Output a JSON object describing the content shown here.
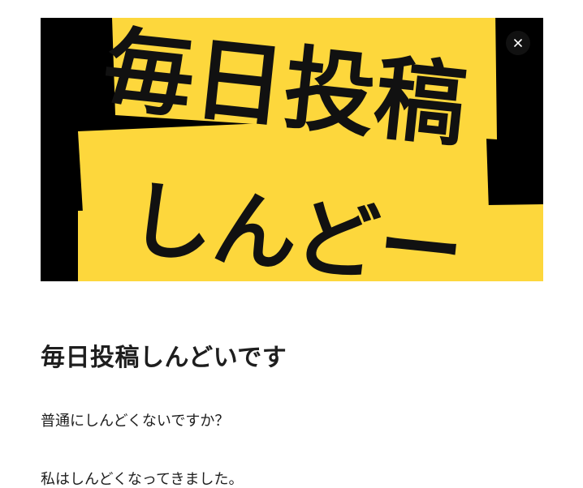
{
  "hero_image": {
    "lines": [
      "毎日投稿",
      "しんどー"
    ],
    "banner_color": "#fdd73c",
    "background_color": "#000000"
  },
  "close_button": {
    "icon": "close-icon"
  },
  "article": {
    "title": "毎日投稿しんどいです",
    "paragraphs": [
      "普通にしんどくないですか？",
      "私はしんどくなってきました。"
    ]
  }
}
